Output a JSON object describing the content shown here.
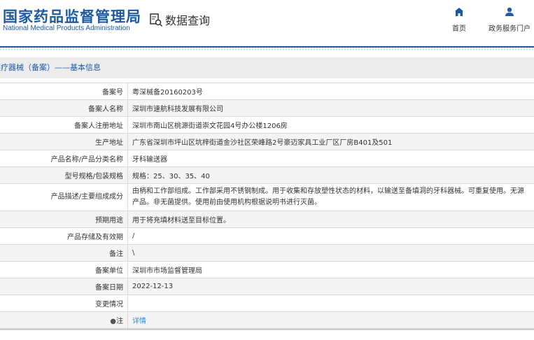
{
  "header": {
    "logo_cn": "国家药品监督管理局",
    "logo_en": "National Medical Products Administration",
    "query_label": "数据查询",
    "nav": [
      {
        "label": "首页",
        "icon": "home-icon"
      },
      {
        "label": "政务服务门户",
        "icon": "user-icon"
      }
    ]
  },
  "colors": {
    "brand": "#1c5aa6",
    "link": "#2a8ae0"
  },
  "section_title": "医疗器械（备案）——基本信息",
  "rows": [
    {
      "label": "备案号",
      "value": "粤深械备20160203号"
    },
    {
      "label": "备案人名称",
      "value": "深圳市速航科技发展有限公司"
    },
    {
      "label": "备案人注册地址",
      "value": "深圳市南山区桃源街道崇文花园4号办公楼1206房"
    },
    {
      "label": "生产地址",
      "value": "广东省深圳市坪山区坑梓街道金沙社区荣峰路2号豪迈家具工业厂区厂房B401及501"
    },
    {
      "label": "产品名称/产品分类名称",
      "value": "牙科输送器"
    },
    {
      "label": "型号规格/包装规格",
      "value": "规格：25、30、35、40"
    },
    {
      "label": "产品描述/主要组成成分",
      "value": "由柄和工作部组成。工作部采用不锈钢制成。用于收集和存放塑性状态的材料，以输送至备填洞的牙科器械。可重复使用。无源产品。非无菌提供。使用前由使用机构根据说明书进行灭菌。"
    },
    {
      "label": "预期用途",
      "value": "用于将充填材料送至目标位置。"
    },
    {
      "label": "产品存储及有效期",
      "value": "/"
    },
    {
      "label": "备注",
      "value": "\\"
    },
    {
      "label": "备案单位",
      "value": "深圳市市场监督管理局"
    },
    {
      "label": "备案日期",
      "value": "2022-12-13"
    },
    {
      "label": "变更情况",
      "value": ""
    }
  ],
  "note": {
    "label": "注",
    "link": "详情"
  }
}
